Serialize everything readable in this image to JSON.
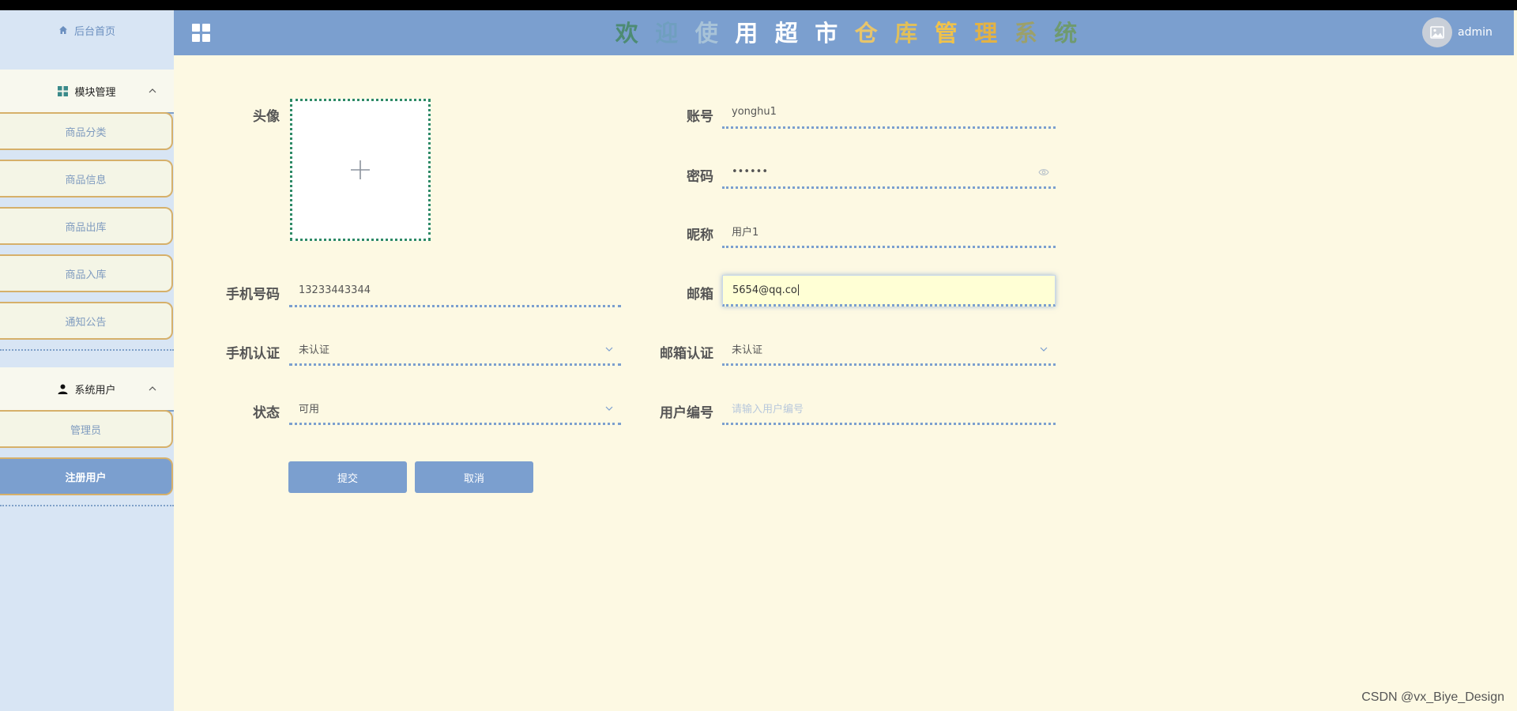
{
  "sidebar": {
    "home": "后台首页",
    "groups": [
      {
        "label": "模块管理",
        "items": [
          "商品分类",
          "商品信息",
          "商品出库",
          "商品入库",
          "通知公告"
        ]
      },
      {
        "label": "系统用户",
        "items": [
          "管理员",
          "注册用户"
        ]
      }
    ],
    "active_item": "注册用户"
  },
  "header": {
    "title_chars": [
      "欢",
      "迎",
      "使",
      "用",
      "超",
      "市",
      "仓",
      "库",
      "管",
      "理",
      "系",
      "统"
    ],
    "title_colors": [
      "#4d8b73",
      "#6f9fbf",
      "#a8c3d8",
      "#ffffff",
      "#ffffff",
      "#ffffff",
      "#e8c56a",
      "#e0bf5a",
      "#f0c24a",
      "#e3b244",
      "#9ca06a",
      "#6f9a6f"
    ],
    "username": "admin"
  },
  "form": {
    "avatar_label": "头像",
    "account": {
      "label": "账号",
      "value": "yonghu1"
    },
    "password": {
      "label": "密码",
      "value": "••••••"
    },
    "nickname": {
      "label": "昵称",
      "value": "用户1"
    },
    "phone": {
      "label": "手机号码",
      "value": "13233443344"
    },
    "email": {
      "label": "邮箱",
      "value": "5654@qq.co"
    },
    "phone_verify": {
      "label": "手机认证",
      "value": "未认证"
    },
    "email_verify": {
      "label": "邮箱认证",
      "value": "未认证"
    },
    "status": {
      "label": "状态",
      "value": "可用"
    },
    "user_no": {
      "label": "用户编号",
      "placeholder": "请输入用户编号"
    },
    "submit": "提交",
    "cancel": "取消"
  },
  "watermark": "CSDN @vx_Biye_Design",
  "colors": {
    "accent": "#7b9fcf",
    "background": "#fdf9e3",
    "sidebar": "#d8e5f4",
    "item_border": "#d6b06a"
  }
}
